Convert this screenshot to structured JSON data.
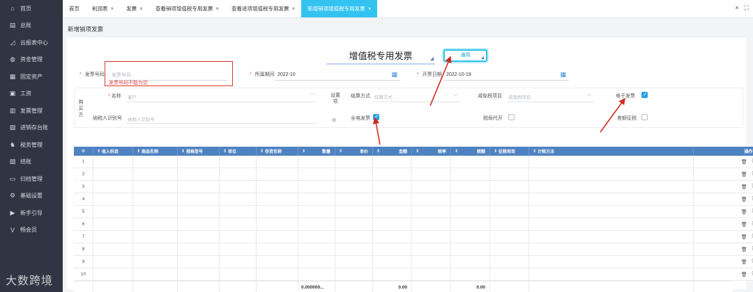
{
  "sidebar": {
    "items": [
      {
        "icon": "home-icon",
        "glyph": "⌂",
        "label": "首页"
      },
      {
        "icon": "ledger-icon",
        "glyph": "▤",
        "label": "总账"
      },
      {
        "icon": "chart-icon",
        "glyph": "◿",
        "label": "云报表中心"
      },
      {
        "icon": "money-icon",
        "glyph": "◍",
        "label": "资金管理"
      },
      {
        "icon": "asset-icon",
        "glyph": "▦",
        "label": "固定资产"
      },
      {
        "icon": "salary-icon",
        "glyph": "▣",
        "label": "工资"
      },
      {
        "icon": "invoice-icon",
        "glyph": "▥",
        "label": "发票管理"
      },
      {
        "icon": "stock-icon",
        "glyph": "▧",
        "label": "进销存台账"
      },
      {
        "icon": "tax-icon",
        "glyph": "♞",
        "label": "税务管理"
      },
      {
        "icon": "close-account-icon",
        "glyph": "▨",
        "label": "结账"
      },
      {
        "icon": "archive-icon",
        "glyph": "▭",
        "label": "归档管理"
      },
      {
        "icon": "settings-icon",
        "glyph": "⚙",
        "label": "基础设置"
      },
      {
        "icon": "guide-icon",
        "glyph": "▶",
        "label": "新手引导"
      },
      {
        "icon": "vip-icon",
        "glyph": "V",
        "label": "畅会员"
      }
    ],
    "watermark": "大数跨境"
  },
  "tabs": [
    {
      "label": "首页",
      "closable": false
    },
    {
      "label": "利润表",
      "closable": true
    },
    {
      "label": "发票",
      "closable": true
    },
    {
      "label": "查看销项增值税专用发票",
      "closable": true
    },
    {
      "label": "查看进项增值税专用发票",
      "closable": true
    },
    {
      "label": "新增销项增值税专用发票",
      "closable": true,
      "active": true
    }
  ],
  "page_title": "新增销项发票",
  "invoice": {
    "type_title": "增值税专用发票",
    "general_button": "通用",
    "number_label": "发票号码",
    "number_placeholder": "发票号码",
    "number_error": "发票号码不能为空",
    "period_label": "所属期间",
    "period_value": "2022-10",
    "date_label": "开票日期",
    "date_value": "2022-10-19"
  },
  "buyer": {
    "side_label": "购买方",
    "name_label": "名称",
    "name_placeholder": "客户",
    "tax_id_label": "纳税人识别号",
    "tax_id_placeholder": "纳税人识别号",
    "settings_label": "设置项",
    "settlement_label": "结算方式",
    "settlement_placeholder": "结算方式",
    "exemption_label": "减免税项目",
    "exemption_placeholder": "减免税项目",
    "e_invoice_label": "电子发票",
    "full_elec_label": "全电发票",
    "tax_agent_label": "税局代开",
    "diff_tax_label": "差额征税"
  },
  "table": {
    "headers": [
      "⚙",
      "收入科目",
      "商品名称",
      "规格型号",
      "单位",
      "存货名称",
      "数量",
      "单价",
      "金额",
      "税率",
      "税额",
      "征税项目",
      "计税方法"
    ],
    "rows": [
      "1",
      "2",
      "3",
      "4",
      "5",
      "6",
      "7",
      "8",
      "9",
      "10"
    ],
    "footer": {
      "quantity": "0.000000...",
      "amount": "0.00",
      "tax": "0.00"
    },
    "ops_header": "操作"
  },
  "colors": {
    "accent": "#33c3f0",
    "header_blue": "#4f82c1",
    "error": "#e04545",
    "sidebar": "#2f3542"
  }
}
